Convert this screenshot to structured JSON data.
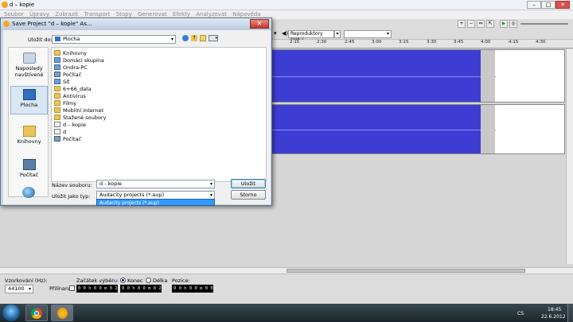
{
  "app": {
    "title": "d – kopie",
    "menu": [
      "Soubor",
      "Úpravy",
      "Zobrazit",
      "Transport",
      "Stopy",
      "Generovat",
      "Efekty",
      "Analyzovat",
      "Nápověda"
    ],
    "device_output": "Reproduktory (VIA I"
  },
  "ruler": {
    "ticks": [
      "2:15",
      "2:30",
      "2:45",
      "3:00",
      "3:15",
      "3:30",
      "3:45",
      "4:00",
      "4:15",
      "4:30"
    ]
  },
  "selection_bar": {
    "rate_label": "Vzorkování (Hz):",
    "rate_value": "44100",
    "snap_label": "Přilínaní",
    "start_label": "Začátek výběru:",
    "end_label": "Konec",
    "length_label": "Délka",
    "position_label": "Pozice:",
    "start_value": "0 0 h 0 0 m 0 2 s",
    "end_value": "0 0 h 0 0 m 0 2 s",
    "position_value": "0 0 h 0 0 m 0 0 s"
  },
  "taskbar": {
    "lang": "CS",
    "time": "18:45",
    "date": "22.6.2012"
  },
  "dialog": {
    "title": "Save Project \"d – kopie\" As...",
    "save_in_label": "Uložit do:",
    "save_in_value": "Plocha",
    "places": [
      {
        "label": "Naposledy navštívené"
      },
      {
        "label": "Plocha"
      },
      {
        "label": "Knihovny"
      },
      {
        "label": "Počítač"
      }
    ],
    "files": [
      {
        "name": "Knihovny",
        "kind": "folder"
      },
      {
        "name": "Domácí skupina",
        "kind": "netw"
      },
      {
        "name": "Ondra-PC",
        "kind": "netw"
      },
      {
        "name": "Počítač",
        "kind": "pc"
      },
      {
        "name": "Síť",
        "kind": "netw"
      },
      {
        "name": "6+66_data",
        "kind": "folder"
      },
      {
        "name": "Antivirus",
        "kind": "folder"
      },
      {
        "name": "Filmy",
        "kind": "folder"
      },
      {
        "name": "Mobilní internet",
        "kind": "folder"
      },
      {
        "name": "Stažené soubory",
        "kind": "folder"
      },
      {
        "name": "d – kopie",
        "kind": "doc"
      },
      {
        "name": "d",
        "kind": "doc"
      },
      {
        "name": "Počítač",
        "kind": "pc"
      }
    ],
    "filename_label": "Název souboru:",
    "filename_value": "d - kopie",
    "filetype_label": "Uložit jako typ:",
    "filetype_value": "Audacity projects (*.aup)",
    "filetype_option": "Audacity projects (*.aup)",
    "save_button": "Uložit",
    "cancel_button": "Storno"
  }
}
